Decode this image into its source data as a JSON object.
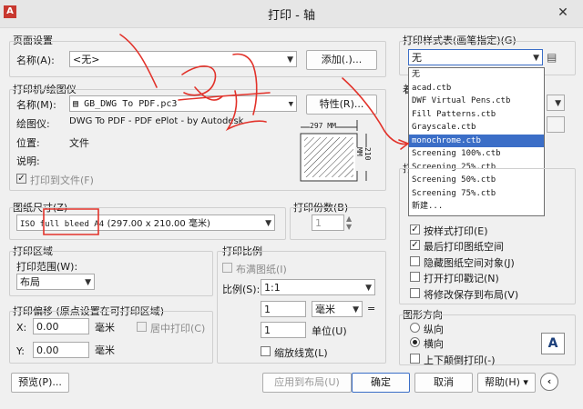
{
  "window": {
    "title": "打印 - 轴",
    "close_glyph": "✕",
    "app_glyph": "A"
  },
  "page_setup": {
    "group_title": "页面设置",
    "name_label": "名称(A):",
    "name_value": "<无>",
    "add_button": "添加(.)..."
  },
  "printer": {
    "group_title": "打印机/绘图仪",
    "name_label": "名称(M):",
    "name_value": "GB_DWG To PDF.pc3",
    "properties_button": "特性(R)...",
    "plotter_label": "绘图仪:",
    "plotter_value": "DWG To PDF - PDF ePlot - by Autodesk",
    "location_label": "位置:",
    "location_value": "文件",
    "desc_label": "说明:",
    "plot_to_file": "打印到文件(F)",
    "preview_width": "297 MM",
    "preview_height": "210 MM"
  },
  "paper_size": {
    "group_title": "图纸尺寸(Z)",
    "value_mono": "ISO full bleed A4",
    "value_rest": "(297.00 x 210.00 毫米)"
  },
  "copies": {
    "label": "打印份数(B)",
    "value": "1"
  },
  "plot_area": {
    "group_title": "打印区域",
    "range_label": "打印范围(W):",
    "range_value": "布局"
  },
  "plot_offset": {
    "group_title": "打印偏移 (原点设置在可打印区域)",
    "x_label": "X:",
    "x_value": "0.00",
    "x_unit": "毫米",
    "y_label": "Y:",
    "y_value": "0.00",
    "y_unit": "毫米",
    "center": "居中打印(C)"
  },
  "plot_scale": {
    "group_title": "打印比例",
    "fit": "布满图纸(I)",
    "scale_label": "比例(S):",
    "scale_value": "1:1",
    "v1": "1",
    "unit_value": "毫米",
    "eq": "=",
    "v2": "1",
    "unit_label": "单位(U)",
    "lineweights": "缩放线宽(L)"
  },
  "style_table": {
    "group_title": "打印样式表(画笔指定)(G)",
    "value": "无",
    "list": [
      "无",
      "acad.ctb",
      "DWF Virtual Pens.ctb",
      "Fill Patterns.ctb",
      "Grayscale.ctb",
      "monochrome.ctb",
      "Screening 100%.ctb",
      "Screening 25%.ctb",
      "Screening 50%.ctb",
      "Screening 75%.ctb",
      "新建..."
    ],
    "selected_index": 5
  },
  "right_labels": {
    "shaded": "着",
    "options": "打"
  },
  "options": [
    "按样式打印(E)",
    "最后打印图纸空间",
    "隐藏图纸空间对象(J)",
    "打开打印戳记(N)",
    "将修改保存到布局(V)"
  ],
  "options_checked": [
    true,
    true,
    false,
    false,
    false
  ],
  "orientation": {
    "group_title": "图形方向",
    "portrait": "纵向",
    "landscape": "横向",
    "upside": "上下颠倒打印(-)",
    "paper_glyph": "A"
  },
  "buttons": {
    "preview": "预览(P)...",
    "apply": "应用到布局(U)",
    "ok": "确定",
    "cancel": "取消",
    "help": "帮助(H)",
    "help_arrow": "▾",
    "more": "‹"
  },
  "colors": {
    "accent": "#3b6ec7",
    "annotation": "#e2322a"
  }
}
